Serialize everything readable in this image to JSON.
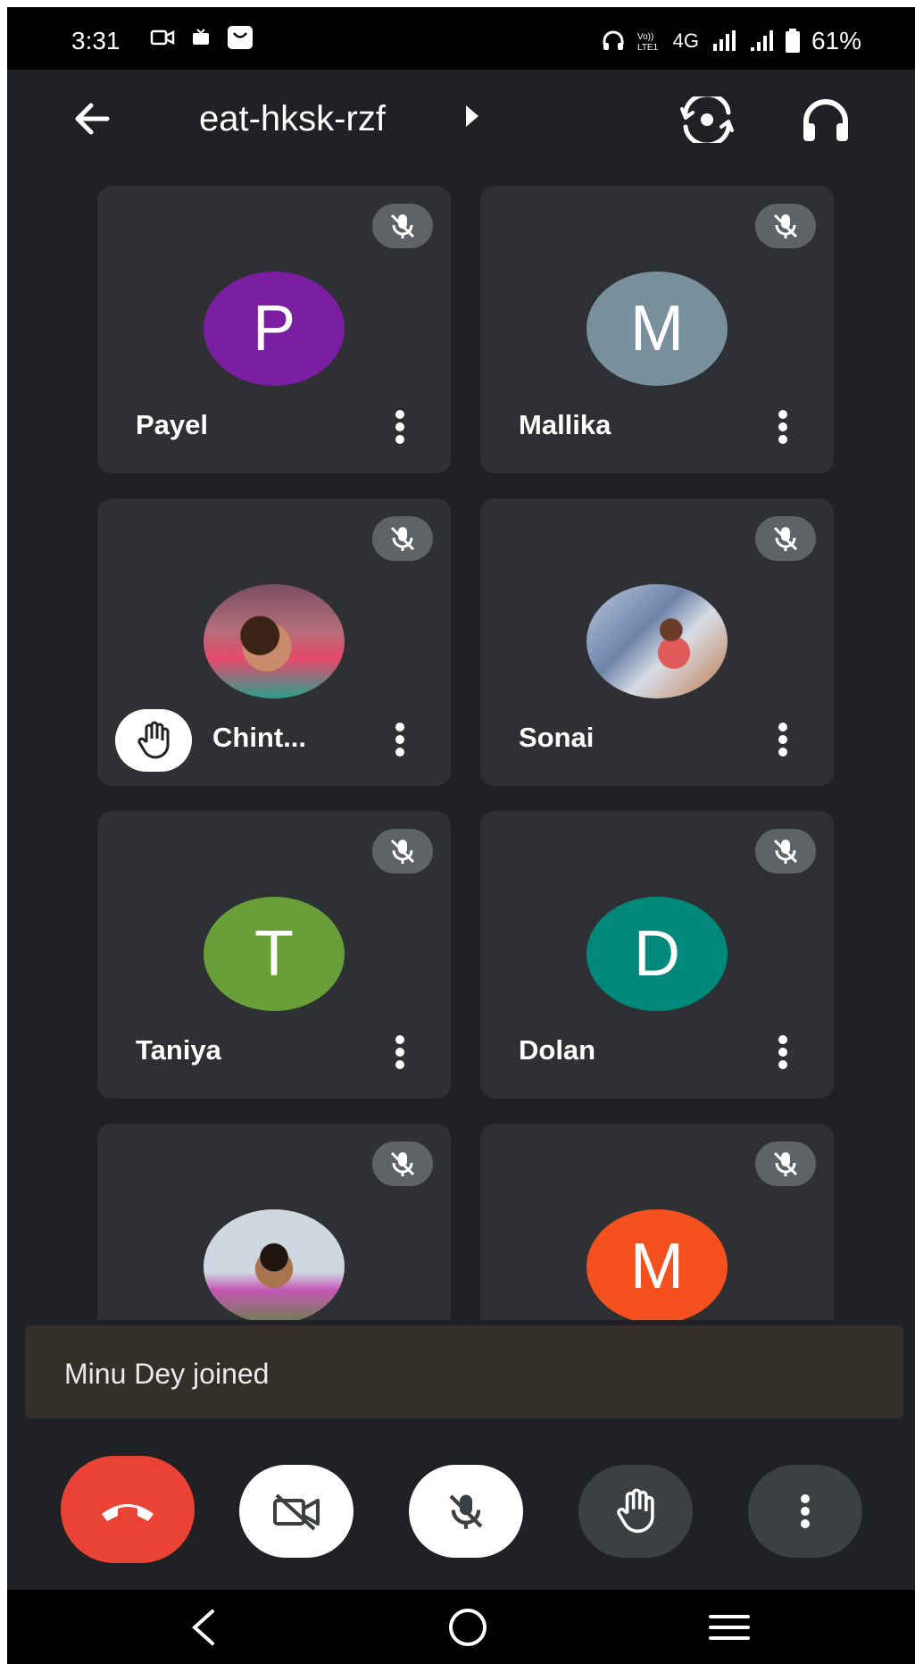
{
  "status_bar": {
    "time": "3:31",
    "battery": "61%",
    "network": "4G",
    "icons_left": [
      "video-call-icon",
      "tv-icon",
      "shopping-bag-icon"
    ],
    "icons_right": [
      "headphones-icon",
      "volte-icon",
      "signal-icon",
      "signal-icon",
      "battery-icon"
    ]
  },
  "header": {
    "meeting_code": "eat-hksk-rzf",
    "icons": [
      "back-arrow-icon",
      "caret-right-icon",
      "switch-camera-icon",
      "headset-icon"
    ]
  },
  "participants": [
    {
      "name": "Payel",
      "initial": "P",
      "color": "#7b1fa2",
      "muted": true,
      "photo": false,
      "hand_raised": false
    },
    {
      "name": "Mallika",
      "initial": "M",
      "color": "#78909c",
      "muted": true,
      "photo": false,
      "hand_raised": false
    },
    {
      "name": "Chint...",
      "initial": "",
      "color": "",
      "muted": true,
      "photo": true,
      "hand_raised": true
    },
    {
      "name": "Sonai",
      "initial": "",
      "color": "",
      "muted": true,
      "photo": true,
      "hand_raised": false
    },
    {
      "name": "Taniya",
      "initial": "T",
      "color": "#689f38",
      "muted": true,
      "photo": false,
      "hand_raised": false
    },
    {
      "name": "Dolan",
      "initial": "D",
      "color": "#00897b",
      "muted": true,
      "photo": false,
      "hand_raised": false
    },
    {
      "name": "",
      "initial": "",
      "color": "",
      "muted": true,
      "photo": true,
      "hand_raised": false
    },
    {
      "name": "",
      "initial": "M",
      "color": "#f4511e",
      "muted": true,
      "photo": false,
      "hand_raised": false
    }
  ],
  "toast": {
    "message": "Minu Dey joined"
  },
  "controls": {
    "end_call_color": "#ea4335",
    "buttons": [
      "end-call-icon",
      "camera-off-icon",
      "mic-off-icon",
      "raise-hand-icon",
      "more-options-icon"
    ]
  },
  "nav": {
    "icons": [
      "nav-back-icon",
      "home-icon",
      "recent-apps-icon"
    ]
  }
}
